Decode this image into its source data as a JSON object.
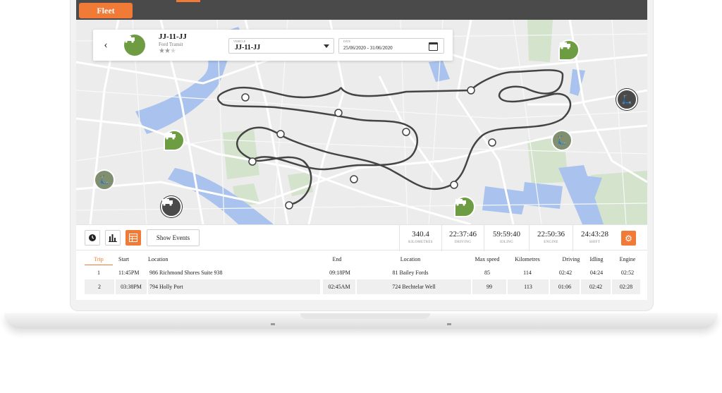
{
  "app": {
    "tab_label": "Fleet"
  },
  "vehicle": {
    "registration": "JJ-11-JJ",
    "model": "Ford Transit",
    "rating": 2,
    "rating_max": 3,
    "select_label": "VEHICLE",
    "select_value": "JJ-11-JJ",
    "date_label": "DATE",
    "date_value": "25/06/2020 - 31/06/2020"
  },
  "controls": {
    "show_events_label": "Show Events"
  },
  "stats": [
    {
      "value": "340.4",
      "label": "KILOMETRES"
    },
    {
      "value": "22:37:46",
      "label": "DRIVING"
    },
    {
      "value": "59:59:40",
      "label": "IDLING"
    },
    {
      "value": "22:50:36",
      "label": "ENGINE"
    },
    {
      "value": "24:43:28",
      "label": "SHIFT"
    }
  ],
  "table": {
    "headers": [
      "Trip",
      "Start",
      "Location",
      "End",
      "Location",
      "Max speed",
      "Kilometres",
      "Driving",
      "Idling",
      "Engine"
    ],
    "rows": [
      [
        "1",
        "11:45PM",
        "986 Richmond Shores Suite 938",
        "09:18PM",
        "81 Bailey Fords",
        "85",
        "114",
        "02:42",
        "04:24",
        "02:52"
      ],
      [
        "2",
        "03:38PM",
        "794 Holly Port",
        "02:45AM",
        "724 Bechtelar Well",
        "99",
        "113",
        "01:06",
        "02:42",
        "02:28"
      ]
    ]
  },
  "colors": {
    "accent": "#f07a36",
    "vehicle_green": "#6e9c43",
    "water": "#a9c3ee",
    "park": "#d3e3cc"
  },
  "icons": [
    "chevron-left-icon",
    "truck-icon",
    "calendar-icon",
    "clock-icon",
    "bar-chart-icon",
    "table-icon",
    "gear-icon",
    "scooter-icon"
  ]
}
